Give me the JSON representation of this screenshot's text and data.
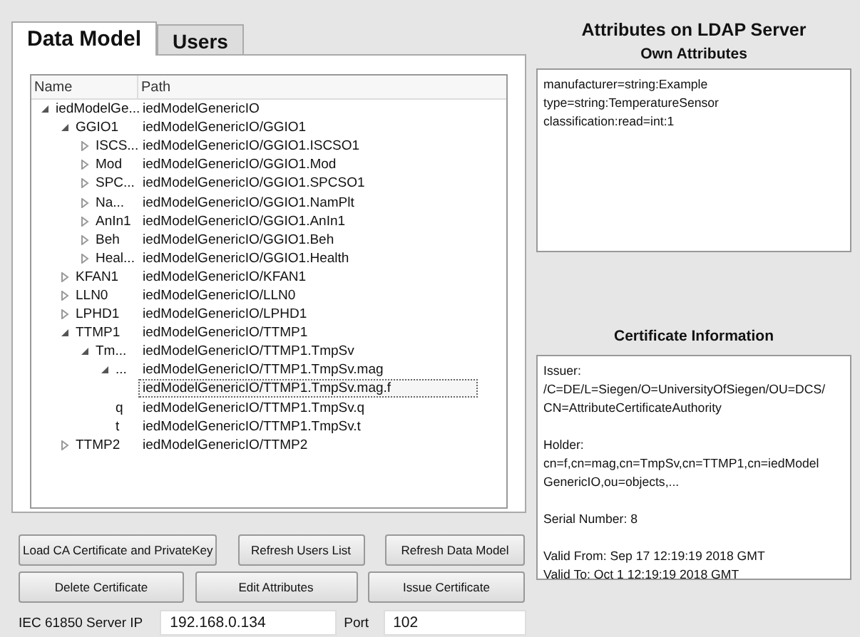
{
  "tabs": [
    {
      "label": "Data Model",
      "selected": true
    },
    {
      "label": "Users",
      "selected": false
    }
  ],
  "tree": {
    "columns": [
      "Name",
      "Path"
    ],
    "nodes": [
      {
        "kind": "branch",
        "expanded": true,
        "name": "iedModelGe...",
        "path": "iedModelGenericIO",
        "selected": false,
        "children": [
          {
            "kind": "branch",
            "expanded": true,
            "name": "GGIO1",
            "path": "iedModelGenericIO/GGIO1",
            "selected": false,
            "children": [
              {
                "kind": "branch",
                "expanded": false,
                "name": "ISCS...",
                "path": "iedModelGenericIO/GGIO1.ISCSO1",
                "selected": false
              },
              {
                "kind": "branch",
                "expanded": false,
                "name": "Mod",
                "path": "iedModelGenericIO/GGIO1.Mod",
                "selected": false
              },
              {
                "kind": "branch",
                "expanded": false,
                "name": "SPC...",
                "path": "iedModelGenericIO/GGIO1.SPCSO1",
                "selected": false
              },
              {
                "kind": "branch",
                "expanded": false,
                "name": "Na...",
                "path": "iedModelGenericIO/GGIO1.NamPlt",
                "selected": false
              },
              {
                "kind": "branch",
                "expanded": false,
                "name": "AnIn1",
                "path": "iedModelGenericIO/GGIO1.AnIn1",
                "selected": false
              },
              {
                "kind": "branch",
                "expanded": false,
                "name": "Beh",
                "path": "iedModelGenericIO/GGIO1.Beh",
                "selected": false
              },
              {
                "kind": "branch",
                "expanded": false,
                "name": "Heal...",
                "path": "iedModelGenericIO/GGIO1.Health",
                "selected": false
              }
            ]
          },
          {
            "kind": "branch",
            "expanded": false,
            "name": "KFAN1",
            "path": "iedModelGenericIO/KFAN1",
            "selected": false
          },
          {
            "kind": "branch",
            "expanded": false,
            "name": "LLN0",
            "path": "iedModelGenericIO/LLN0",
            "selected": false
          },
          {
            "kind": "branch",
            "expanded": false,
            "name": "LPHD1",
            "path": "iedModelGenericIO/LPHD1",
            "selected": false
          },
          {
            "kind": "branch",
            "expanded": true,
            "name": "TTMP1",
            "path": "iedModelGenericIO/TTMP1",
            "selected": false,
            "children": [
              {
                "kind": "branch",
                "expanded": true,
                "name": "Tm...",
                "path": "iedModelGenericIO/TTMP1.TmpSv",
                "selected": false,
                "children": [
                  {
                    "kind": "branch",
                    "expanded": true,
                    "name": "...",
                    "path": "iedModelGenericIO/TTMP1.TmpSv.mag",
                    "selected": false,
                    "children": [
                      {
                        "kind": "leaf",
                        "path": "iedModelGenericIO/TTMP1.TmpSv.mag.f",
                        "selected": true
                      }
                    ]
                  },
                  {
                    "kind": "leaf",
                    "name": "q",
                    "path": "iedModelGenericIO/TTMP1.TmpSv.q",
                    "selected": false
                  },
                  {
                    "kind": "leaf",
                    "name": "t",
                    "path": "iedModelGenericIO/TTMP1.TmpSv.t",
                    "selected": false
                  }
                ]
              }
            ]
          },
          {
            "kind": "branch",
            "expanded": false,
            "name": "TTMP2",
            "path": "iedModelGenericIO/TTMP2",
            "selected": false
          }
        ]
      }
    ]
  },
  "buttons_row_1": [
    "Load CA Certificate and PrivateKey",
    "Refresh Users List",
    "Refresh Data Model"
  ],
  "buttons_row_2": [
    "Delete Certificate",
    "Edit Attributes",
    "Issue Certificate"
  ],
  "server": {
    "ip_label": "IEC 61850 Server IP",
    "ip": "192.168.0.134",
    "port_label": "Port",
    "port": "102"
  },
  "attributes": {
    "title": "Attributes on LDAP Server",
    "own_title": "Own Attributes",
    "own": [
      "manufacturer=string:Example",
      "type=string:TemperatureSensor",
      "classification:read=int:1"
    ]
  },
  "certificate": {
    "title": "Certificate Information",
    "paragraphs": [
      [
        "Issuer:",
        "/C=DE/L=Siegen/O=UniversityOfSiegen/OU=DCS/",
        "CN=AttributeCertificateAuthority"
      ],
      [
        "Holder:",
        "cn=f,cn=mag,cn=TmpSv,cn=TTMP1,cn=iedModel",
        "GenericIO,ou=objects,..."
      ],
      [
        "Serial Number: 8"
      ],
      [
        "Valid From: Sep 17 12:19:19 2018 GMT",
        "Valid To: Oct 1 12:19:19 2018 GMT"
      ]
    ]
  }
}
